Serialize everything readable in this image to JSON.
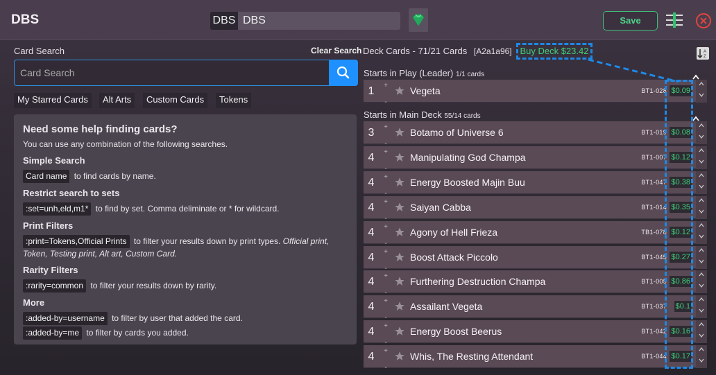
{
  "app": {
    "title": "DBS",
    "format_label": "DBS",
    "deck_name": "DBS",
    "save_label": "Save"
  },
  "left": {
    "search_label": "Card Search",
    "clear_label": "Clear Search",
    "search_placeholder": "Card Search",
    "tabs": [
      "My Starred Cards",
      "Alt Arts",
      "Custom Cards",
      "Tokens"
    ]
  },
  "help": {
    "title": "Need some help finding cards?",
    "subtitle": "You can use any combination of the following searches.",
    "simple_title": "Simple Search",
    "simple_code": "Card name",
    "simple_text": "to find cards by name.",
    "sets_title": "Restrict search to sets",
    "sets_code": ":set=unh,eld,m1*",
    "sets_text": "to find by set. Comma deliminate or * for wildcard.",
    "print_title": "Print Filters",
    "print_code": ":print=Tokens,Official Prints",
    "print_text": "to filter your results down by print types.",
    "print_types": "Official print, Token, Testing print, Alt art, Custom Card.",
    "rarity_title": "Rarity Filters",
    "rarity_code": ":rarity=common",
    "rarity_text": "to filter your results down by rarity.",
    "more_title": "More",
    "more_code1": ":added-by=username",
    "more_text1": "to filter by user that added the card.",
    "more_code2": ":added-by=me",
    "more_text2": "to filter by cards you added."
  },
  "deck": {
    "header": "Deck Cards - 71/21 Cards",
    "hash": "[A2a1a96]",
    "buy_label": "Buy Deck $23.42",
    "leader_section": "Starts in Play (Leader)",
    "leader_count": "1/1 cards",
    "main_section": "Starts in Main Deck",
    "main_count": "55/14 cards",
    "leader": {
      "qty": "1",
      "name": "Vegeta",
      "set": "BT1-028",
      "price": "$0.09"
    },
    "main": [
      {
        "qty": "3",
        "name": "Botamo of Universe 6",
        "set": "BT1-019",
        "price": "$0.08"
      },
      {
        "qty": "4",
        "name": "Manipulating God Champa",
        "set": "BT1-007",
        "price": "$0.12"
      },
      {
        "qty": "4",
        "name": "Energy Boosted Majin Buu",
        "set": "BT1-047",
        "price": "$0.38"
      },
      {
        "qty": "4",
        "name": "Saiyan Cabba",
        "set": "BT1-014",
        "price": "$0.35"
      },
      {
        "qty": "4",
        "name": "Agony of Hell Frieza",
        "set": "TB1-078",
        "price": "$0.12"
      },
      {
        "qty": "4",
        "name": "Boost Attack Piccolo",
        "set": "BT1-045",
        "price": "$0.27"
      },
      {
        "qty": "4",
        "name": "Furthering Destruction Champa",
        "set": "BT1-005",
        "price": "$0.86"
      },
      {
        "qty": "4",
        "name": "Assailant Vegeta",
        "set": "BT1-037",
        "price": "$0.1"
      },
      {
        "qty": "4",
        "name": "Energy Boost Beerus",
        "set": "BT1-042",
        "price": "$0.16"
      },
      {
        "qty": "4",
        "name": "Whis, The Resting Attendant",
        "set": "BT1-044",
        "price": "$0.17"
      }
    ]
  },
  "colors": {
    "accent_blue": "#1e90ff",
    "price_green": "#3ecf7a",
    "close_red": "#e0453f"
  }
}
